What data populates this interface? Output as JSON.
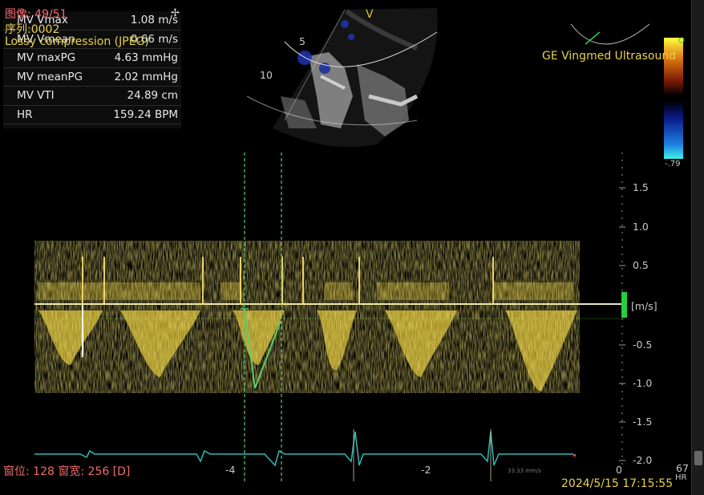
{
  "overlay": {
    "image_counter": "图像: 49/51",
    "series": "序列:0002",
    "lossy": "Lossy compression (JPEG)",
    "window": "窗位: 128 窗宽: 256 [D]",
    "timestamp": "2024/5/15 17:15:55"
  },
  "measurements": [
    {
      "label": "MV Vmax",
      "value": "1.08 m/s"
    },
    {
      "label": "MV Vmean",
      "value": "0.66 m/s"
    },
    {
      "label": "MV maxPG",
      "value": "4.63 mmHg"
    },
    {
      "label": "MV meanPG",
      "value": "2.02 mmHg"
    },
    {
      "label": "MV VTI",
      "value": "24.89 cm"
    },
    {
      "label": "HR",
      "value": "159.24 BPM"
    }
  ],
  "device": {
    "brand": "GE Vingmed Ultrasound",
    "view_marker": "V"
  },
  "sector": {
    "depth_5": "5",
    "depth_10": "10"
  },
  "color_bar": {
    "bottom": "-.79"
  },
  "velocity_axis": {
    "unit": "[m/s]",
    "ticks": [
      "1.5",
      "1.0",
      "0.5",
      "-0.5",
      "-1.0",
      "-1.5",
      "-2.0"
    ]
  },
  "time_axis": {
    "ticks": [
      "-4",
      "-2",
      "0"
    ]
  },
  "ecg": {
    "speed": "33.33 mm/s"
  },
  "misc": {
    "hr_small": "67",
    "hr_unit": "HR"
  },
  "colors": {
    "doppler": "#e6c832",
    "ecg": "#2fb9b9",
    "caliper": "#5ad06a",
    "overlay_red": "#f06a6a",
    "overlay_yellow": "#e8d24a"
  }
}
